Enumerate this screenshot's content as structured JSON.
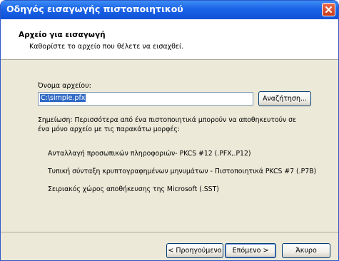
{
  "window": {
    "title": "Οδηγός εισαγωγής πιστοποιητικού"
  },
  "header": {
    "title": "Αρχείο για εισαγωγή",
    "description": "Καθορίστε το αρχείο που θέλετε να εισαχθεί."
  },
  "form": {
    "filename_label": "Όνομα αρχείου:",
    "filename_value": "C:\\simple.pfx",
    "browse_label": "Αναζήτηση..."
  },
  "note": {
    "text": "Σημείωση:  Περισσότερα από ένα πιστοποιητικά μπορούν να αποθηκευτούν σε ένα μόνο αρχείο με τις παρακάτω μορφές:",
    "formats": [
      "Ανταλλαγή προσωπικών πληροφοριών- PKCS #12 (.PFX,.P12)",
      "Τυπική σύνταξη κρυπτογραφημένων μηνυμάτων - Πιστοποιητικά PKCS #7 (.P7B)",
      "Σειριακός χώρος αποθήκευσης της Microsoft (.SST)"
    ]
  },
  "footer": {
    "back_label": "< Προηγούμενο",
    "next_label": "Επόμενο >",
    "cancel_label": "Άκυρο"
  }
}
